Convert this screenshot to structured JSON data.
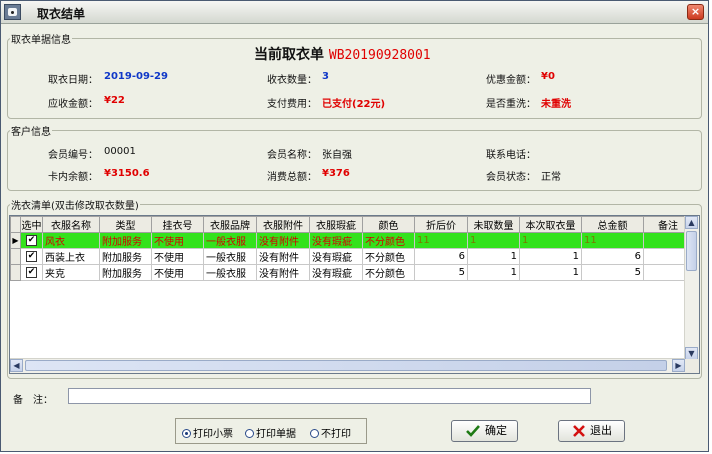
{
  "window": {
    "title": "取衣结单",
    "close_label": "×",
    "icon": "app-icon"
  },
  "order_section": {
    "legend": "取衣单据信息",
    "header_label": "当前取衣单",
    "order_no": "WB20190928001",
    "fields": {
      "pickup_date": {
        "label": "取衣日期：",
        "value": "2019-09-29"
      },
      "pickup_qty": {
        "label": "收衣数量：",
        "value": "3"
      },
      "discount": {
        "label": "优惠金额：",
        "value": "¥0"
      },
      "receivable": {
        "label": "应收金额：",
        "value": "¥22"
      },
      "payment": {
        "label": "支付费用：",
        "value": "已支付(22元)"
      },
      "rewash": {
        "label": "是否重洗：",
        "value": "未重洗"
      }
    }
  },
  "customer_section": {
    "legend": "客户信息",
    "fields": {
      "member_no": {
        "label": "会员编号：",
        "value": "00001"
      },
      "member_name": {
        "label": "会员名称：",
        "value": "张自强"
      },
      "phone": {
        "label": "联系电话：",
        "value": ""
      },
      "card_balance": {
        "label": "卡内余额：",
        "value": "¥3150.6"
      },
      "total_spent": {
        "label": "消费总额：",
        "value": "¥376"
      },
      "member_status": {
        "label": "会员状态：",
        "value": "正常"
      }
    }
  },
  "wash_list": {
    "legend": "洗衣清单(双击修改取衣数量)",
    "columns": [
      "选中",
      "衣服名称",
      "类型",
      "挂衣号",
      "衣服品牌",
      "衣服附件",
      "衣服瑕疵",
      "颜色",
      "折后价",
      "未取数量",
      "本次取衣量",
      "总金额",
      "备注"
    ],
    "rows": [
      {
        "current": true,
        "checked": "✔",
        "cells": [
          "风衣",
          "附加服务",
          "不使用",
          "一般衣服",
          "没有附件",
          "没有瑕疵",
          "不分颜色",
          "11",
          "1",
          "1",
          "11",
          ""
        ]
      },
      {
        "current": false,
        "checked": "✔",
        "cells": [
          "西装上衣",
          "附加服务",
          "不使用",
          "一般衣服",
          "没有附件",
          "没有瑕疵",
          "不分颜色",
          "6",
          "1",
          "1",
          "6",
          ""
        ]
      },
      {
        "current": false,
        "checked": "✔",
        "cells": [
          "夹克",
          "附加服务",
          "不使用",
          "一般衣服",
          "没有附件",
          "没有瑕疵",
          "不分颜色",
          "5",
          "1",
          "1",
          "5",
          ""
        ]
      }
    ]
  },
  "remark": {
    "label": "备　注：",
    "value": ""
  },
  "print_options": {
    "selected": 0,
    "options": [
      "打印小票",
      "打印单据",
      "不打印"
    ]
  },
  "buttons": {
    "confirm": "确定",
    "exit": "退出"
  },
  "colors": {
    "selected_row": "#33e21c",
    "accent_red": "#e00000",
    "accent_blue": "#1038c8"
  }
}
